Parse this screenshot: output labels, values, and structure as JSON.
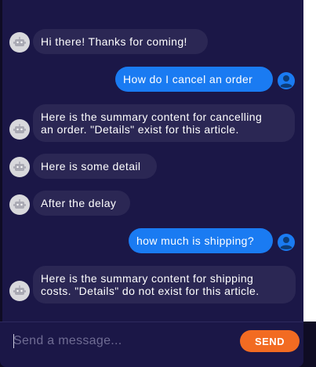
{
  "messages": [
    {
      "sender": "bot",
      "lines": [
        "Hi there! Thanks for coming!"
      ]
    },
    {
      "sender": "user",
      "lines": [
        "How do I cancel an order"
      ]
    },
    {
      "sender": "bot",
      "lines": [
        "Here is the summary content for cancelling",
        "an order. \"Details\" exist for this article."
      ]
    },
    {
      "sender": "bot",
      "lines": [
        "Here is some detail"
      ]
    },
    {
      "sender": "bot",
      "lines": [
        "After the delay"
      ]
    },
    {
      "sender": "user",
      "lines": [
        "how much is shipping?"
      ]
    },
    {
      "sender": "bot",
      "lines": [
        "Here is the summary content for shipping",
        "costs. \"Details\" do not exist for this article."
      ]
    }
  ],
  "composer": {
    "placeholder": "Send a message...",
    "value": "",
    "send_label": "SEND"
  },
  "icons": {
    "bot_avatar": "robot-icon",
    "user_avatar": "user-icon"
  },
  "colors": {
    "background": "#1b1747",
    "bot_bubble": "#2b2754",
    "user_bubble": "#1a7bf2",
    "send_button": "#f26b22",
    "user_avatar": "#1a7bf2"
  }
}
